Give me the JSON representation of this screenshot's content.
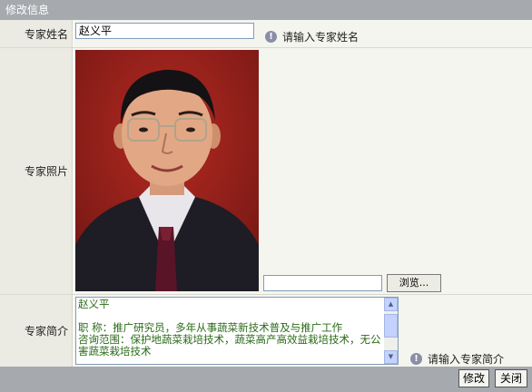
{
  "titlebar": {
    "title": "修改信息"
  },
  "name_row": {
    "label": "专家姓名",
    "value": "赵义平",
    "hint": "请输入专家姓名"
  },
  "photo_row": {
    "label": "专家照片",
    "browse_label": "浏览..."
  },
  "intro_row": {
    "label": "专家简介",
    "text": "赵义平\n\n职 称：推广研究员，多年从事蔬菜新技术普及与推广工作\n咨询范围：保护地蔬菜栽培技术，蔬菜高产高效益栽培技术，无公害蔬菜栽培技术",
    "hint": "请输入专家简介"
  },
  "footer": {
    "modify_label": "修改",
    "close_label": "关闭"
  },
  "colors": {
    "titlebar": "#a6a9ad",
    "label_bg": "#ebebe3",
    "intro_text": "#2b6a18"
  }
}
